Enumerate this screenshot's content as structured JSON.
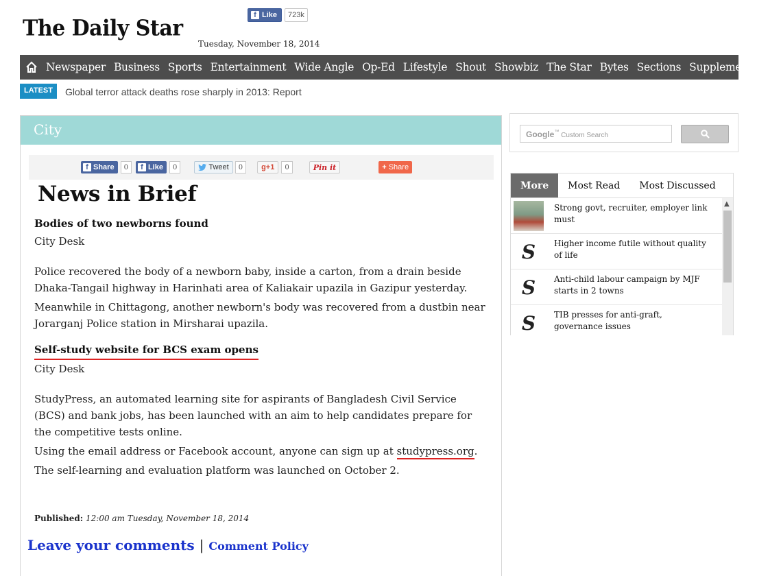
{
  "header": {
    "logo": "The Daily Star",
    "fb_like_label": "Like",
    "fb_like_count": "723k",
    "date": "Tuesday, November 18, 2014"
  },
  "nav": {
    "items": [
      "Newspaper",
      "Business",
      "Sports",
      "Entertainment",
      "Wide Angle",
      "Op-Ed",
      "Lifestyle",
      "Shout",
      "Showbiz",
      "The Star",
      "Bytes",
      "Sections",
      "Supplement"
    ]
  },
  "latest": {
    "tag": "LATEST",
    "text": "Global terror attack deaths rose sharply in 2013: Report"
  },
  "section": {
    "name": "City"
  },
  "share": {
    "fb_share": "Share",
    "fb_share_count": "0",
    "fb_like": "Like",
    "fb_like_count": "0",
    "tweet": "Tweet",
    "tweet_count": "0",
    "gplus": "g+1",
    "gplus_count": "0",
    "pinit": "Pin it",
    "share": "Share"
  },
  "article": {
    "title": "News in Brief",
    "story1": {
      "headline": "Bodies of two newborns found",
      "byline": "City Desk",
      "p1": "Police recovered the body of a newborn baby, inside a carton, from a drain beside Dhaka-Tangail highway in Harinhati area of Kaliakair upazila in Gazipur yesterday.",
      "p2": "Meanwhile in Chittagong, another newborn's body was recovered from a dustbin near Jorarganj Police station in Mirsharai upazila."
    },
    "story2": {
      "headline": "Self-study website for BCS exam opens",
      "byline": "City Desk",
      "p1": "StudyPress, an automated learning site for aspirants of Bangladesh Civil Service (BCS) and bank jobs, has been launched with an aim to help candidates prepare for the competitive tests online.",
      "p2_prefix": "Using the email address or Facebook account, anyone can sign up at ",
      "p2_link": "studypress.org",
      "p2_suffix": ".",
      "p3": "The self-learning and evaluation platform was launched on October 2."
    },
    "published_label": "Published:",
    "published_value": "12:00 am Tuesday, November 18, 2014"
  },
  "comments": {
    "leave": "Leave your comments",
    "separator": "|",
    "policy": "Comment Policy"
  },
  "search": {
    "google": "Google",
    "tm": "™",
    "placeholder": "Custom Search"
  },
  "sidebar": {
    "tabs": [
      "More",
      "Most Read",
      "Most Discussed"
    ],
    "items": [
      "Strong govt, recruiter, employer link must",
      "Higher income futile without quality of life",
      "Anti-child labour campaign by MJF starts in 2 towns",
      "TIB presses for anti-graft, governance issues"
    ],
    "logo_glyph": "S"
  }
}
